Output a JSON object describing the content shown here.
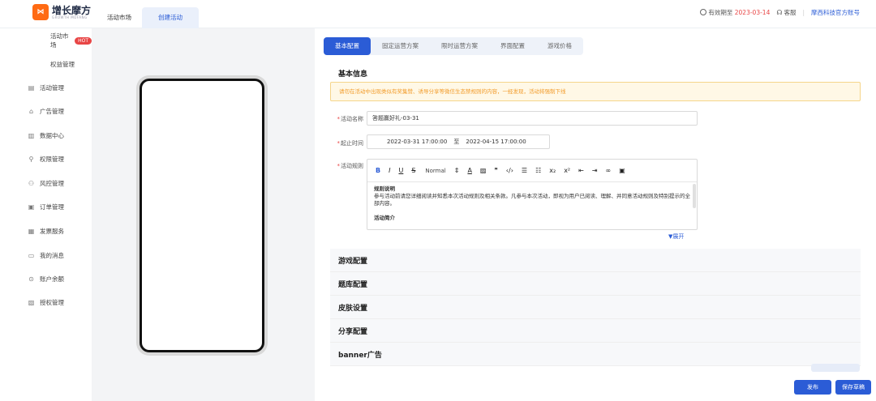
{
  "brand": {
    "name": "增长摩方",
    "sub": "GROWTH MOFANG",
    "logo_glyph": "⋈"
  },
  "top_tabs": [
    "活动市场",
    "创建活动"
  ],
  "header": {
    "validity_label": "有效期至",
    "validity_date": "2023-03-14",
    "service_label": "客服",
    "account": "摩西科技官方账号"
  },
  "sidebar": {
    "items": [
      {
        "label": "活动市场",
        "icon": "",
        "badge": "HOT"
      },
      {
        "label": "权益管理",
        "icon": ""
      },
      {
        "label": "活动管理",
        "icon": "▤"
      },
      {
        "label": "广告管理",
        "icon": "⌂"
      },
      {
        "label": "数据中心",
        "icon": "▥"
      },
      {
        "label": "权限管理",
        "icon": "⚲"
      },
      {
        "label": "风控管理",
        "icon": "⚇"
      },
      {
        "label": "订单管理",
        "icon": "▣"
      },
      {
        "label": "发票服务",
        "icon": "▦"
      },
      {
        "label": "我的消息",
        "icon": "▭"
      },
      {
        "label": "账户余额",
        "icon": "⊙"
      },
      {
        "label": "授权管理",
        "icon": "▧"
      }
    ]
  },
  "tabs": [
    "基本配置",
    "固定运营方案",
    "限时运营方案",
    "界面配置",
    "游戏价格"
  ],
  "basic": {
    "title": "基本信息",
    "hint": "",
    "warning": "请勿在活动中出现类似有奖集赞、诱导分享等微信生态禁规则的内容，一经发现，活动将强制下线"
  },
  "form": {
    "name_label": "活动名称",
    "name_value": "答题赢好礼-03-31",
    "time_label": "起止时间",
    "start_time": "2022-03-31 17:00:00",
    "time_sep": "至",
    "end_time": "2022-04-15 17:00:00",
    "rules_label": "活动规则",
    "toolbar_normal": "Normal"
  },
  "editor": {
    "heading1": "规则说明",
    "para1": "参与活动前请您详细阅读并知悉本次活动规则及相关条款。凡参与本次活动，即视为用户已阅读、理解、并同意活动规则及特别提示的全部内容。",
    "heading2": "活动简介",
    "expand": "▼展开"
  },
  "sections": [
    {
      "title": "游戏配置"
    },
    {
      "title": "题库配置"
    },
    {
      "title": "皮肤设置"
    },
    {
      "title": "分享配置"
    },
    {
      "title": "banner广告"
    }
  ],
  "buttons": {
    "publish": "发布",
    "save": "保存草稿"
  }
}
